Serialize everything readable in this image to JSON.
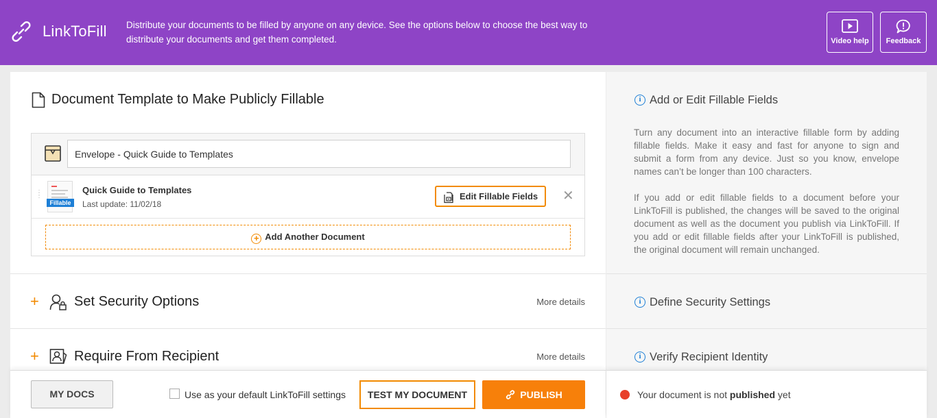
{
  "header": {
    "app_name": "LinkToFill",
    "description": "Distribute your documents to be filled by anyone on any device. See the options below to choose the best way to distribute your documents and get them completed.",
    "video_help_label": "Video help",
    "feedback_label": "Feedback",
    "background_color": "#8e44c6"
  },
  "document_section": {
    "title": "Document Template to Make Publicly Fillable",
    "envelope_name": "Envelope - Quick Guide to Templates",
    "documents": [
      {
        "name": "Quick Guide to Templates",
        "last_update": "Last update: 11/02/18",
        "badge": "Fillable",
        "edit_label": "Edit Fillable Fields"
      }
    ],
    "add_document_label": "Add Another Document"
  },
  "sections": {
    "security": {
      "title": "Set Security Options",
      "more_details": "More details"
    },
    "recipient": {
      "title": "Require From Recipient",
      "more_details": "More details"
    }
  },
  "info_panel": {
    "fillable_title": "Add or Edit Fillable Fields",
    "fillable_para1": "Turn any document into an interactive fillable form by adding fillable fields. Make it easy and fast for anyone to sign and submit a form from any device. Just so you know, envelope names can’t be longer than 100 characters.",
    "fillable_para2": "If you add or edit fillable fields to a document before your LinkToFill is published, the changes will be saved to the original document as well as the document you publish via LinkToFill. If you add or edit fillable fields after your LinkToFill is published, the original document will remain unchanged.",
    "security_title": "Define Security Settings",
    "recipient_title": "Verify Recipient Identity"
  },
  "footer": {
    "my_docs_label": "MY DOCS",
    "default_settings_label": "Use as your default LinkToFill settings",
    "default_settings_checked": false,
    "test_label": "TEST MY DOCUMENT",
    "publish_label": "PUBLISH",
    "status_prefix": "Your document is not ",
    "status_bold": "published",
    "status_suffix": " yet",
    "accent_color": "#f7800a",
    "status_color": "#e8402a"
  }
}
